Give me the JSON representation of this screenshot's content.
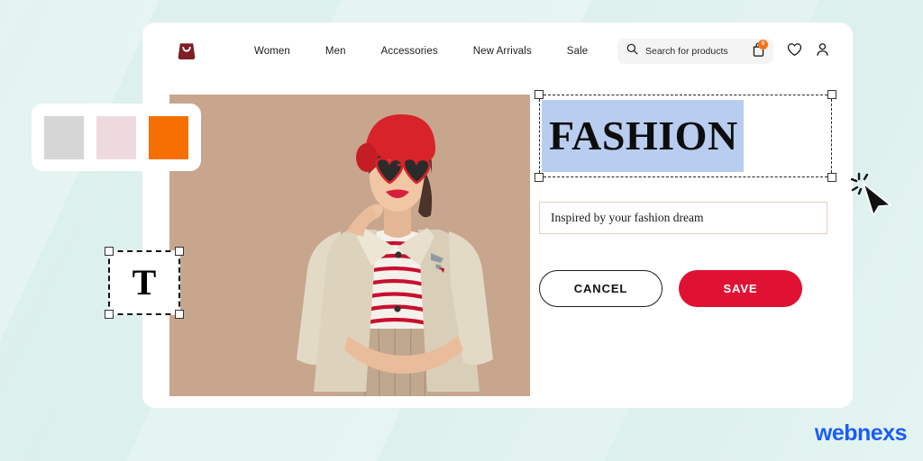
{
  "brand": {
    "name": "webnexs",
    "color": "#1b5cf5"
  },
  "card": {
    "navbar": {
      "logo_icon": "shopping-bag-icon",
      "logo_color": "#7d1f24",
      "links": [
        {
          "label": "Women"
        },
        {
          "label": "Men"
        },
        {
          "label": "Accessories"
        },
        {
          "label": "New Arrivals"
        },
        {
          "label": "Sale"
        }
      ],
      "search": {
        "icon": "search-icon",
        "value": "Search for products",
        "placeholder": "Search for products"
      },
      "bag": {
        "icon": "shopping-bag-icon",
        "badge_count": "0",
        "badge_color": "#f97316"
      },
      "wishlist": {
        "icon": "heart-icon"
      },
      "account": {
        "icon": "user-icon"
      }
    },
    "hero_photo": {
      "alt": "smiling-woman-red-beret-heart-sunglasses-beige-trench-coat",
      "background_color": "#c8a68d"
    },
    "editor": {
      "title": {
        "text": "FASHION",
        "highlight_color": "#b8cdf0",
        "selected": true
      },
      "subtitle": {
        "value": "Inspired by your fashion dream",
        "placeholder": "Inspired by your fashion dream",
        "border_color": "#e7cdb9"
      },
      "buttons": {
        "cancel_label": "CANCEL",
        "save_label": "SAVE",
        "save_color": "#e01234"
      }
    }
  },
  "overlays": {
    "swatch_panel": {
      "swatches": [
        {
          "name": "light-gray",
          "color": "#d6d6d6"
        },
        {
          "name": "blush-pink",
          "color": "#eedade"
        },
        {
          "name": "orange",
          "color": "#f57000"
        }
      ]
    },
    "text_tool": {
      "glyph": "T",
      "name": "text-tool"
    },
    "cursor": {
      "name": "click-cursor"
    }
  }
}
